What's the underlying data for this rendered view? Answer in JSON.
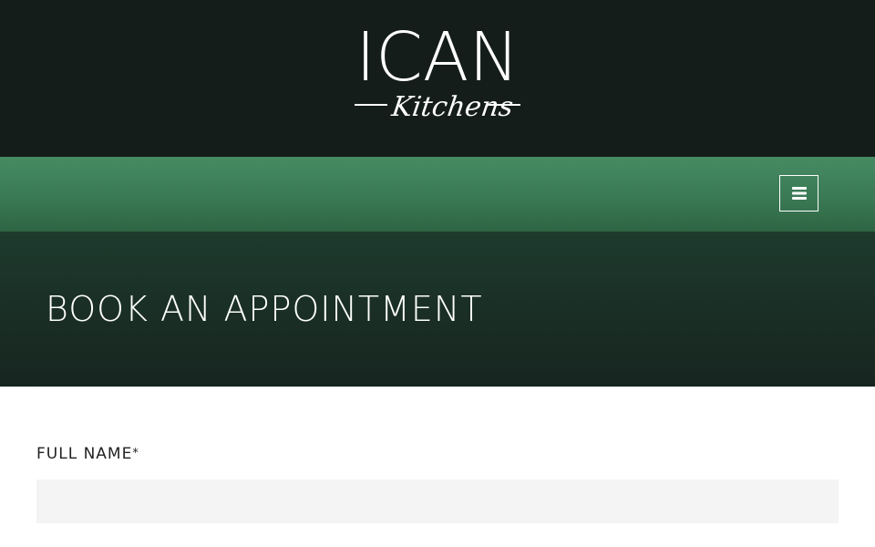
{
  "header": {
    "logo": {
      "main_text": "ICAN",
      "script_text": "Kitchens"
    }
  },
  "nav": {
    "menu_icon": "bars-icon"
  },
  "hero": {
    "title": "BOOK AN APPOINTMENT"
  },
  "form": {
    "full_name": {
      "label": "FULL NAME",
      "required_mark": "*",
      "value": "",
      "placeholder": ""
    }
  },
  "colors": {
    "header_bg": "#141d1a",
    "nav_green": "#3f8159",
    "hero_bg": "#1a2e25",
    "input_bg": "#f4f4f4",
    "text_white": "#ffffff"
  }
}
